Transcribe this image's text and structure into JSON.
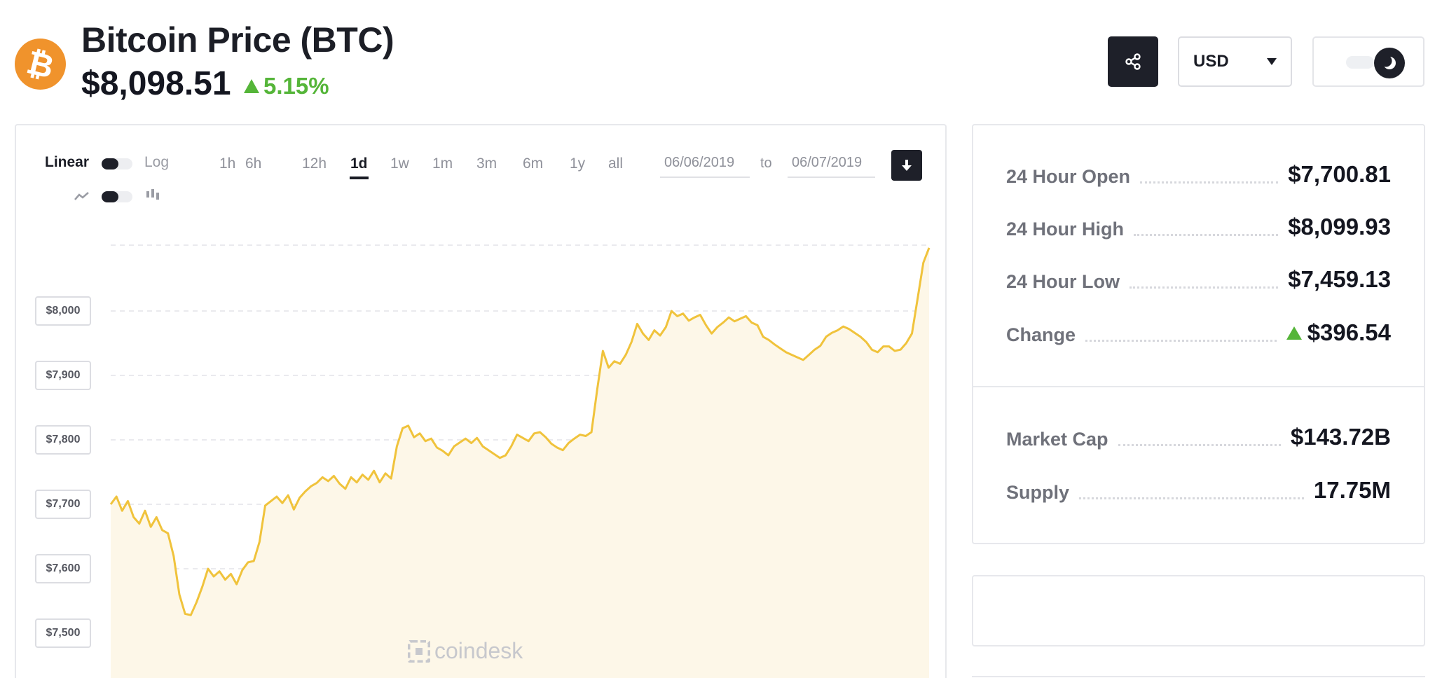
{
  "header": {
    "logo_symbol": "₿",
    "title": "Bitcoin Price (BTC)",
    "price": "$8,098.51",
    "change_pct": "5.15%",
    "change_direction": "up",
    "share_icon": "share-icon",
    "currency": "USD",
    "theme_icon": "moon-icon"
  },
  "controls": {
    "scale_linear": "Linear",
    "scale_log": "Log",
    "ranges": [
      "1h",
      "6h",
      "12h",
      "1d",
      "1w",
      "1m",
      "3m",
      "6m",
      "1y",
      "all"
    ],
    "active_range": "1d",
    "date_from": "06/06/2019",
    "date_separator": "to",
    "date_to": "06/07/2019",
    "download_icon": "download-icon",
    "chart_style_line_icon": "line-chart-icon",
    "chart_style_candle_icon": "candlestick-icon"
  },
  "watermark": "coindesk",
  "stats": {
    "open_label": "24 Hour Open",
    "open_value": "$7,700.81",
    "high_label": "24 Hour High",
    "high_value": "$8,099.93",
    "low_label": "24 Hour Low",
    "low_value": "$7,459.13",
    "change_label": "Change",
    "change_value": "$396.54",
    "market_cap_label": "Market Cap",
    "market_cap_value": "$143.72B",
    "supply_label": "Supply",
    "supply_value": "17.75M"
  },
  "colors": {
    "accent_line": "#f0c33c",
    "area_fill": "#fdf7e8",
    "positive": "#55b539",
    "bitcoin_orange": "#f0932c",
    "dark": "#1e2029"
  },
  "chart_data": {
    "type": "area",
    "title": "",
    "xlabel": "",
    "ylabel": "",
    "ylim": [
      7470,
      8110
    ],
    "yticks": [
      8000,
      7900,
      7800,
      7700,
      7600,
      7500
    ],
    "ytick_labels": [
      "$8,000",
      "$7,900",
      "$7,800",
      "$7,700",
      "$7,600",
      "$7,500"
    ],
    "grid": true,
    "series": [
      {
        "values": [
          7700,
          7712,
          7690,
          7705,
          7680,
          7670,
          7690,
          7665,
          7680,
          7660,
          7655,
          7620,
          7560,
          7530,
          7528,
          7548,
          7572,
          7600,
          7588,
          7596,
          7583,
          7592,
          7576,
          7598,
          7610,
          7612,
          7642,
          7698,
          7705,
          7712,
          7702,
          7714,
          7692,
          7710,
          7720,
          7728,
          7733,
          7742,
          7736,
          7744,
          7732,
          7724,
          7742,
          7734,
          7746,
          7738,
          7752,
          7734,
          7748,
          7740,
          7790,
          7818,
          7822,
          7804,
          7810,
          7798,
          7802,
          7788,
          7783,
          7776,
          7790,
          7796,
          7802,
          7795,
          7803,
          7790,
          7784,
          7778,
          7772,
          7776,
          7790,
          7808,
          7803,
          7798,
          7810,
          7812,
          7804,
          7794,
          7788,
          7784,
          7795,
          7802,
          7808,
          7806,
          7812,
          7878,
          7938,
          7912,
          7922,
          7918,
          7932,
          7952,
          7980,
          7965,
          7955,
          7970,
          7962,
          7975,
          8000,
          7992,
          7996,
          7985,
          7990,
          7994,
          7978,
          7965,
          7975,
          7982,
          7990,
          7984,
          7988,
          7992,
          7982,
          7978,
          7960,
          7955,
          7948,
          7942,
          7936,
          7932,
          7928,
          7924,
          7932,
          7940,
          7946,
          7960,
          7966,
          7970,
          7976,
          7972,
          7966,
          7960,
          7952,
          7940,
          7936,
          7945,
          7945,
          7938,
          7940,
          7950,
          7965,
          8020,
          8075,
          8098
        ]
      }
    ]
  }
}
